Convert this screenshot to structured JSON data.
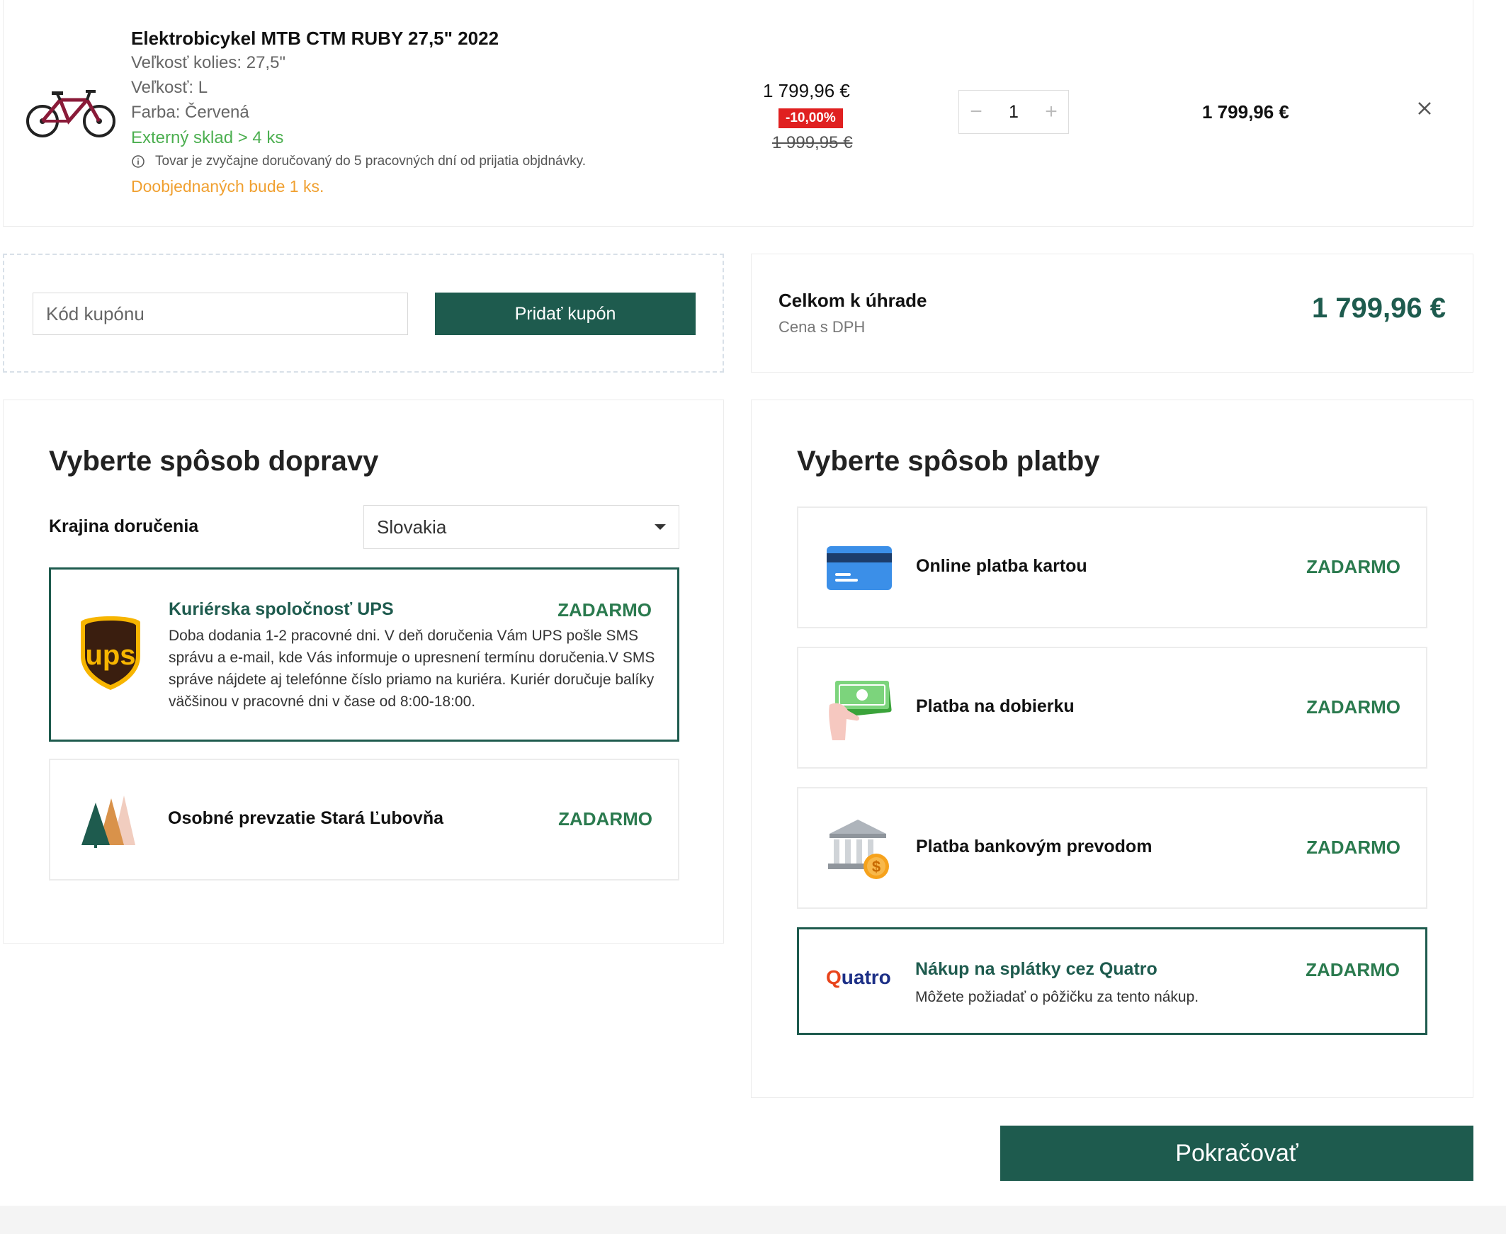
{
  "cart": {
    "item": {
      "title": "Elektrobicykel MTB CTM RUBY 27,5\" 2022",
      "wheel_size": "Veľkosť kolies: 27,5\"",
      "size": "Veľkosť: L",
      "color": "Farba: Červená",
      "stock": "Externý sklad > 4 ks",
      "delivery_note": "Tovar je zvyčajne doručovaný do 5 pracovných dní od prijatia objdnávky.",
      "reorder_note": "Doobjednaných bude 1 ks.",
      "price": "1 799,96 €",
      "discount": "-10,00%",
      "old_price": "1 999,95 €",
      "qty_minus": "−",
      "quantity": "1",
      "qty_plus": "+",
      "total": "1 799,96 €",
      "remove": "×"
    }
  },
  "coupon": {
    "placeholder": "Kód kupónu",
    "button": "Pridať kupón"
  },
  "summary": {
    "title": "Celkom k úhrade",
    "subtitle": "Cena s DPH",
    "total": "1 799,96 €"
  },
  "shipping": {
    "heading": "Vyberte spôsob dopravy",
    "country_label": "Krajina doručenia",
    "country_value": "Slovakia",
    "options": [
      {
        "title": "Kuriérska spoločnosť UPS",
        "price": "ZADARMO",
        "desc1": "Doba dodania 1-2 pracovné dni. V deň doručenia Vám UPS pošle SMS",
        "desc2": "správu a e-mail, kde Vás informuje o upresnení termínu doručenia.V SMS",
        "desc3": "správe nájdete aj telefónne číslo priamo na kuriéra. Kuriér doručuje balíky",
        "desc4": "väčšinou v pracovné dni v čase od 8:00-18:00.",
        "icon": "ups-logo-icon"
      },
      {
        "title": "Osobné prevzatie Stará Ľubovňa",
        "price": "ZADARMO",
        "icon": "trees-icon"
      }
    ]
  },
  "payment": {
    "heading": "Vyberte spôsob platby",
    "options": [
      {
        "title": "Online platba kartou",
        "price": "ZADARMO",
        "icon": "credit-card-icon"
      },
      {
        "title": "Platba na dobierku",
        "price": "ZADARMO",
        "icon": "cash-hand-icon"
      },
      {
        "title": "Platba bankovým prevodom",
        "price": "ZADARMO",
        "icon": "bank-icon"
      },
      {
        "title": "Nákup na splátky cez Quatro",
        "price": "ZADARMO",
        "desc": "Môžete požiadať o pôžičku za tento nákup.",
        "logo": "Quatro",
        "icon": "quatro-logo-icon"
      }
    ]
  },
  "continue_button": "Pokračovať",
  "colors": {
    "primary": "#1e5b4e",
    "price_green": "#2a7a4e",
    "badge_red": "#e02020",
    "stock_green": "#4caf50",
    "reorder_orange": "#f0a030"
  }
}
